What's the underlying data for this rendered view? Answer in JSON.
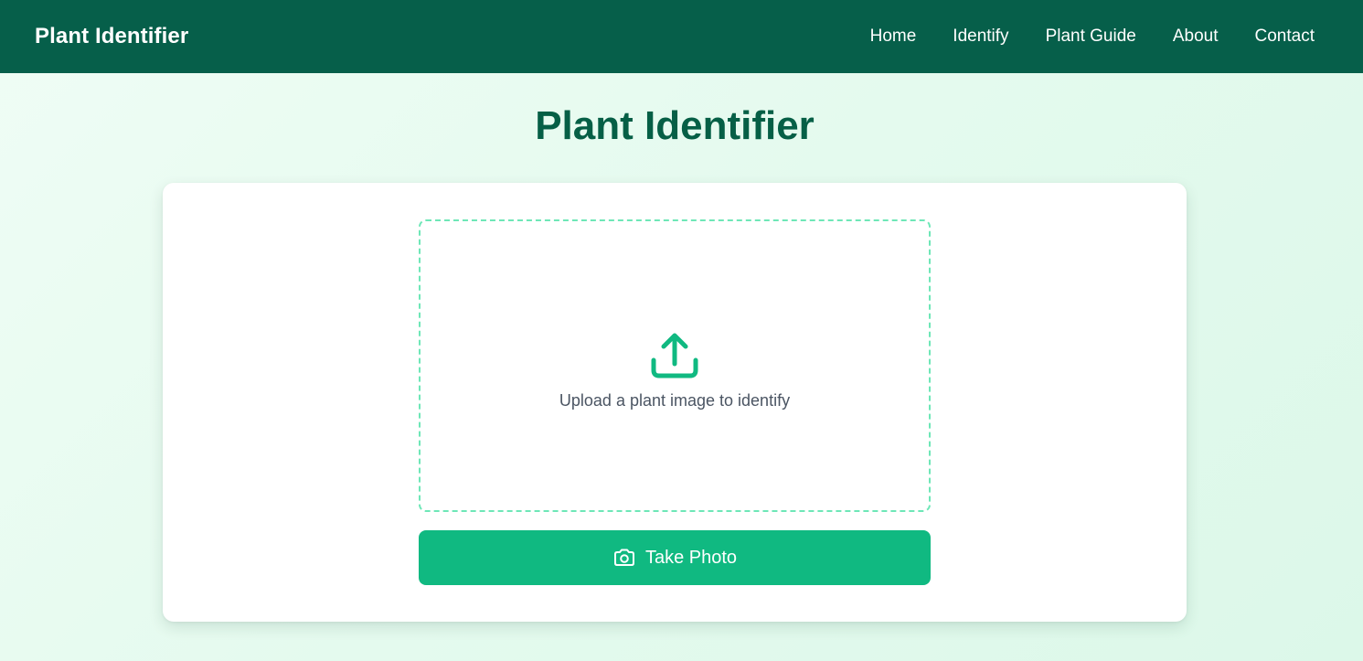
{
  "header": {
    "brand": "Plant Identifier",
    "nav": [
      "Home",
      "Identify",
      "Plant Guide",
      "About",
      "Contact"
    ]
  },
  "main": {
    "title": "Plant Identifier",
    "upload": {
      "icon": "upload-icon",
      "text": "Upload a plant image to identify"
    },
    "take_photo": {
      "icon": "camera-icon",
      "label": "Take Photo"
    }
  },
  "colors": {
    "nav_background": "#065f4a",
    "title": "#065f46",
    "accent": "#10b981",
    "dropzone_border": "#6ee7b7"
  }
}
